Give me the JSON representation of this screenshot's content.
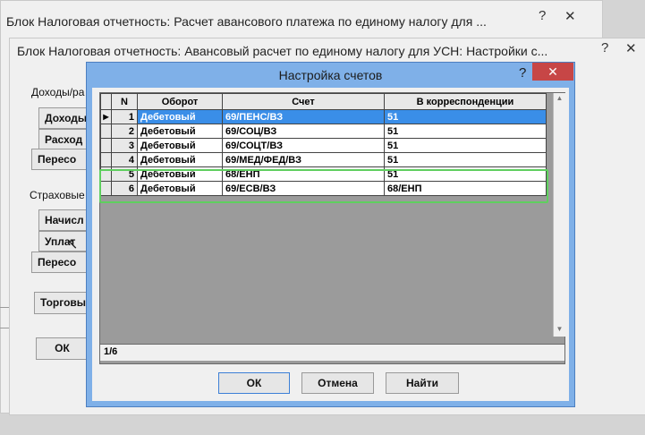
{
  "window1": {
    "title": "Блок Налоговая отчетность: Расчет авансового платежа по единому налогу для ...",
    "help": "?",
    "close": "✕"
  },
  "window2": {
    "title": "Блок Налоговая отчетность: Авансовый расчет по единому налогу для УСН: Настройки с...",
    "help": "?",
    "close": "✕",
    "section_income": "Доходы/ра",
    "btn_income": "Доходы",
    "btn_expense": "Расход",
    "btn_recalc1": "Пересо",
    "section_insurance": "Страховые",
    "btn_accrual": "Начисл",
    "btn_payment": "Уплат",
    "btn_recalc2": "Пересо",
    "btn_trade": "Торговы",
    "btn_ok": "ОК"
  },
  "dialog": {
    "title": "Настройка счетов",
    "help": "?",
    "close": "✕",
    "columns": [
      "N",
      "Оборот",
      "Счет",
      "В корреспонденции"
    ],
    "rows": [
      {
        "n": "1",
        "turnover": "Дебетовый",
        "account": "69/ПЕНС/ВЗ",
        "corr": "51"
      },
      {
        "n": "2",
        "turnover": "Дебетовый",
        "account": "69/СОЦ/ВЗ",
        "corr": "51"
      },
      {
        "n": "3",
        "turnover": "Дебетовый",
        "account": "69/СОЦТ/ВЗ",
        "corr": "51"
      },
      {
        "n": "4",
        "turnover": "Дебетовый",
        "account": "69/МЕД/ФЕД/ВЗ",
        "corr": "51"
      },
      {
        "n": "5",
        "turnover": "Дебетовый",
        "account": "68/ЕНП",
        "corr": "51"
      },
      {
        "n": "6",
        "turnover": "Дебетовый",
        "account": "69/ЕСВ/ВЗ",
        "corr": "68/ЕНП"
      }
    ],
    "status": "1/6",
    "btn_ok": "ОК",
    "btn_cancel": "Отмена",
    "btn_find": "Найти"
  },
  "colors": {
    "dialog_frame": "#7fb0e8",
    "selection": "#3a8ee8",
    "highlight_box": "#5fcf5f",
    "close_button": "#c74646"
  }
}
